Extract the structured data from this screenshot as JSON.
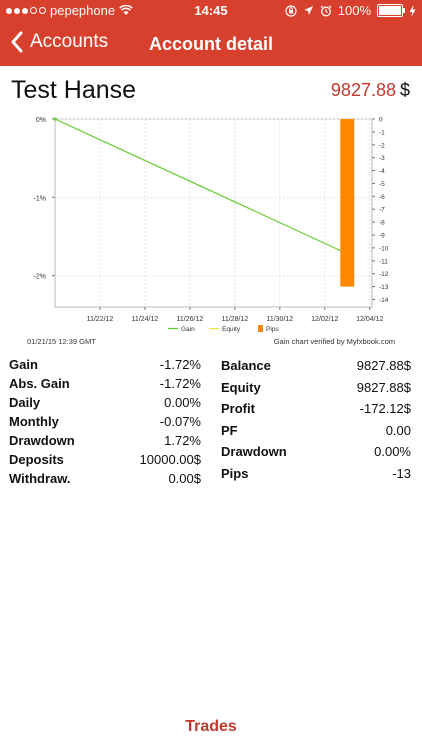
{
  "status": {
    "carrier": "pepephone",
    "time": "14:45",
    "battery": "100%"
  },
  "nav": {
    "back_label": "Accounts",
    "title": "Account detail"
  },
  "account": {
    "name": "Test Hanse",
    "balance_value": "9827.88",
    "currency": "$"
  },
  "chart_footer": {
    "timestamp": "01/21/15 12:39 GMT",
    "verified": "Gain chart verified by Myfxbook.com"
  },
  "chart_data": {
    "type": "line",
    "x_dates": [
      "11/20/12",
      "12/03/12"
    ],
    "x_ticks": [
      "11/22/12",
      "11/24/12",
      "11/26/12",
      "11/28/12",
      "11/30/12",
      "12/02/12",
      "12/04/12"
    ],
    "y_left_ticks": [
      "0%",
      "-1%",
      "-2%"
    ],
    "y_left_range": [
      -2.4,
      0
    ],
    "y_right_ticks": [
      "0",
      "-1",
      "-2",
      "-3",
      "-4",
      "-5",
      "-6",
      "-7",
      "-8",
      "-9",
      "-10",
      "-11",
      "-12",
      "-13",
      "-14"
    ],
    "y_right_range": [
      -14,
      0
    ],
    "series": [
      {
        "name": "Gain",
        "color": "#66cc33",
        "axis": "left",
        "points": [
          [
            "11/20/12",
            0
          ],
          [
            "12/03/12",
            -1.72
          ]
        ]
      },
      {
        "name": "Equity",
        "color": "#e8e83a",
        "axis": "left",
        "points": []
      },
      {
        "name": "Pips",
        "color": "#ff8800",
        "axis": "right",
        "type": "bar",
        "points": [
          [
            "12/03/12",
            -13
          ]
        ]
      }
    ],
    "legend": "bottom-center",
    "grid": true
  },
  "stats_left": [
    {
      "label": "Gain",
      "value": "-1.72%"
    },
    {
      "label": "Abs. Gain",
      "value": "-1.72%"
    },
    {
      "label": "Daily",
      "value": "0.00%"
    },
    {
      "label": "Monthly",
      "value": "-0.07%"
    },
    {
      "label": "Drawdown",
      "value": "1.72%"
    },
    {
      "label": "Deposits",
      "value": "10000.00$"
    },
    {
      "label": "Withdraw.",
      "value": "0.00$"
    }
  ],
  "stats_right": [
    {
      "label": "Balance",
      "value": "9827.88$"
    },
    {
      "label": "Equity",
      "value": "9827.88$"
    },
    {
      "label": "Profit",
      "value": "-172.12$"
    },
    {
      "label": "PF",
      "value": "0.00"
    },
    {
      "label": "Drawdown",
      "value": "0.00%"
    },
    {
      "label": "Pips",
      "value": "-13"
    }
  ],
  "footer": {
    "trades_label": "Trades"
  }
}
